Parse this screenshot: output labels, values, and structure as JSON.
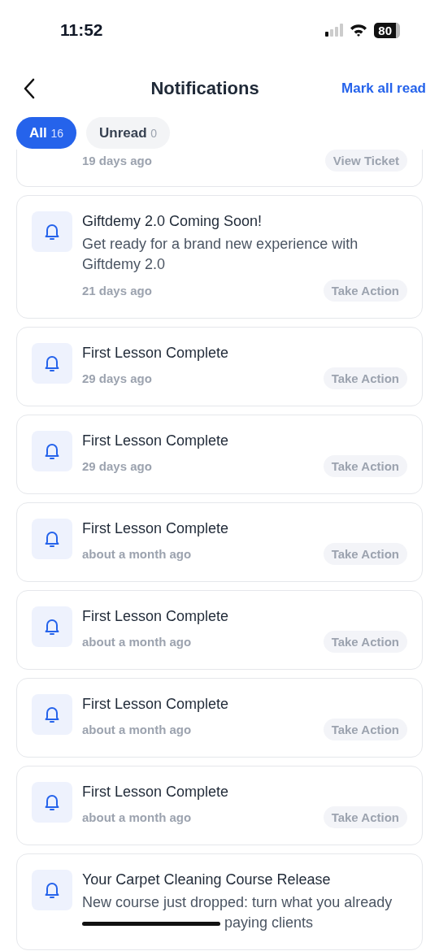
{
  "status_bar": {
    "time": "11:52",
    "battery": "80"
  },
  "header": {
    "title": "Notifications",
    "action": "Mark all read"
  },
  "tabs": [
    {
      "label": "All",
      "count": "16",
      "selected": true
    },
    {
      "label": "Unread",
      "count": "0",
      "selected": false
    }
  ],
  "notifications": [
    {
      "kind": "cut",
      "time": "19 days ago",
      "action": "View Ticket"
    },
    {
      "kind": "full",
      "title": "Giftdemy 2.0 Coming Soon!",
      "body": [
        {
          "kind": "text",
          "text": "Get ready for a brand new experience with Giftdemy 2.0"
        }
      ],
      "time": "21 days ago",
      "action": "Take Action"
    },
    {
      "kind": "full",
      "title": "First Lesson Complete",
      "time": "29 days ago",
      "action": "Take Action"
    },
    {
      "kind": "full",
      "title": "First Lesson Complete",
      "time": "29 days ago",
      "action": "Take Action"
    },
    {
      "kind": "full",
      "title": "First Lesson Complete",
      "time": "about a month ago",
      "action": "Take Action"
    },
    {
      "kind": "full",
      "title": "First Lesson Complete",
      "time": "about a month ago",
      "action": "Take Action"
    },
    {
      "kind": "full",
      "title": "First Lesson Complete",
      "time": "about a month ago",
      "action": "Take Action"
    },
    {
      "kind": "full",
      "title": "First Lesson Complete",
      "time": "about a month ago",
      "action": "Take Action"
    },
    {
      "kind": "full",
      "title": "Your Carpet Cleaning Course Release",
      "body": [
        {
          "kind": "text",
          "text": "New course just dropped: turn what you already"
        },
        {
          "kind": "redaction"
        },
        {
          "kind": "text",
          "text": "paying clients"
        }
      ]
    }
  ]
}
